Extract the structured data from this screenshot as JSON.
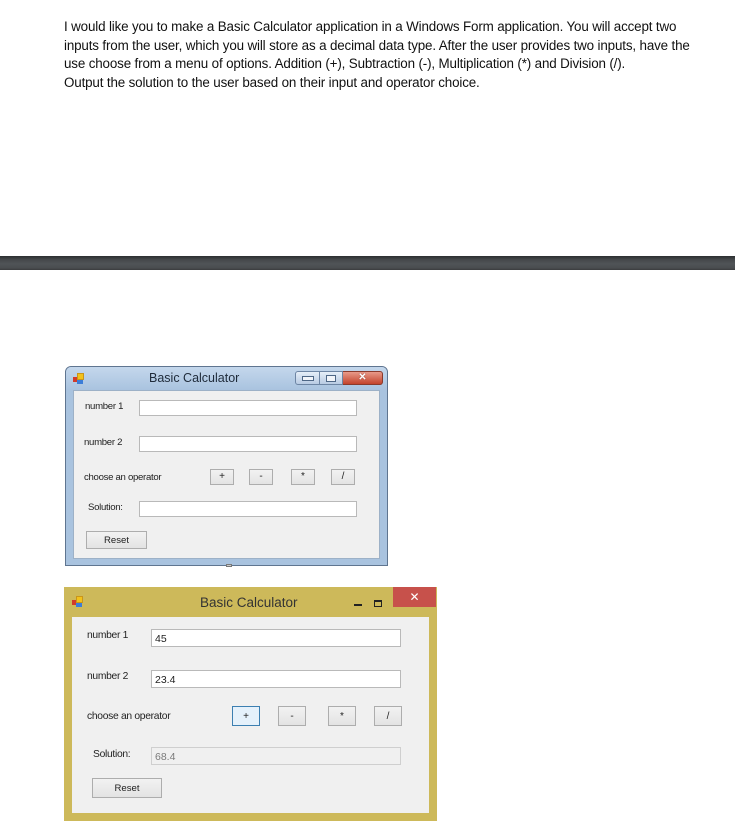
{
  "prompt": {
    "lines": [
      "I would like you to make a Basic Calculator application in a Windows Form application. You will accept two inputs from the user, which you will store as a decimal data type. After the user provides two inputs, have the use choose from a menu of options. Addition (+), Subtraction (-), Multiplication (*) and Division (/).",
      "Output the solution to the user based on their input and operator choice."
    ]
  },
  "window_design": {
    "title": "Basic Calculator",
    "icons": {
      "app": "app-icon",
      "minimize": "minimize-icon",
      "maximize": "maximize-icon",
      "close": "close-icon"
    },
    "close_glyph": "✕",
    "number1_label": "number 1",
    "number1_value": "",
    "number2_label": "number 2",
    "number2_value": "",
    "operator_label": "choose an operator",
    "operators": [
      "+",
      "-",
      "*",
      "/"
    ],
    "solution_label": "Solution:",
    "solution_value": "",
    "reset_label": "Reset"
  },
  "window_running": {
    "title": "Basic Calculator",
    "close_glyph": "✕",
    "number1_label": "number 1",
    "number1_value": "45",
    "number2_label": "number 2",
    "number2_value": "23.4",
    "operator_label": "choose an operator",
    "operators": [
      "+",
      "-",
      "*",
      "/"
    ],
    "focused_operator": "+",
    "solution_label": "Solution:",
    "solution_value": "68.4",
    "reset_label": "Reset"
  },
  "colors": {
    "aero_title": "#a9c3df",
    "win8_frame": "#cdb95a",
    "win8_close": "#c7514b",
    "client_bg": "#f0f0f0",
    "divider_bar": "#4a4d50"
  }
}
